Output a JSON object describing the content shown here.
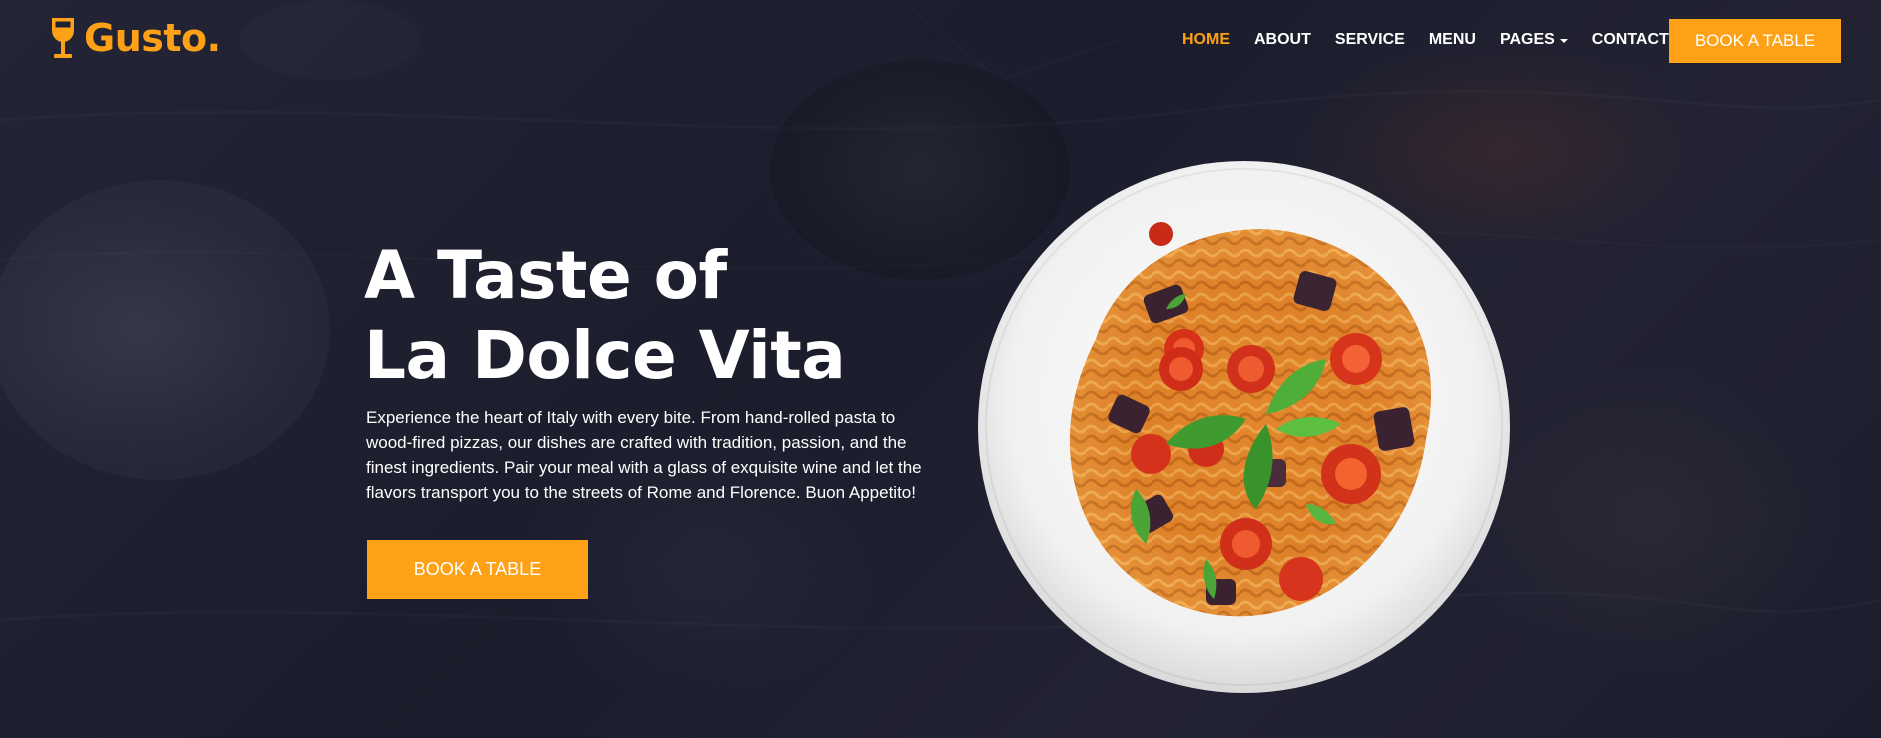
{
  "brand": {
    "name": "Gusto.",
    "icon": "wine-glass-icon",
    "accent_color": "#fea116"
  },
  "nav": {
    "items": [
      {
        "label": "HOME",
        "active": true
      },
      {
        "label": "ABOUT",
        "active": false
      },
      {
        "label": "SERVICE",
        "active": false
      },
      {
        "label": "MENU",
        "active": false
      },
      {
        "label": "PAGES",
        "active": false,
        "dropdown": true
      },
      {
        "label": "CONTACT",
        "active": false
      }
    ],
    "cta_label": "BOOK A TABLE"
  },
  "hero": {
    "headline_line1": "A Taste of",
    "headline_line2": "La Dolce Vita",
    "description": "Experience the heart of Italy with every bite. From hand-rolled pasta to wood-fired pizzas, our dishes are crafted with tradition, passion, and the finest ingredients. Pair your meal with a glass of exquisite wine and let the flavors transport you to the streets of Rome and Florence. Buon Appetito!",
    "cta_label": "BOOK A TABLE",
    "image": "pasta-plate-image"
  },
  "colors": {
    "background": "#1d1f30",
    "accent": "#fea116",
    "text": "#ffffff"
  }
}
